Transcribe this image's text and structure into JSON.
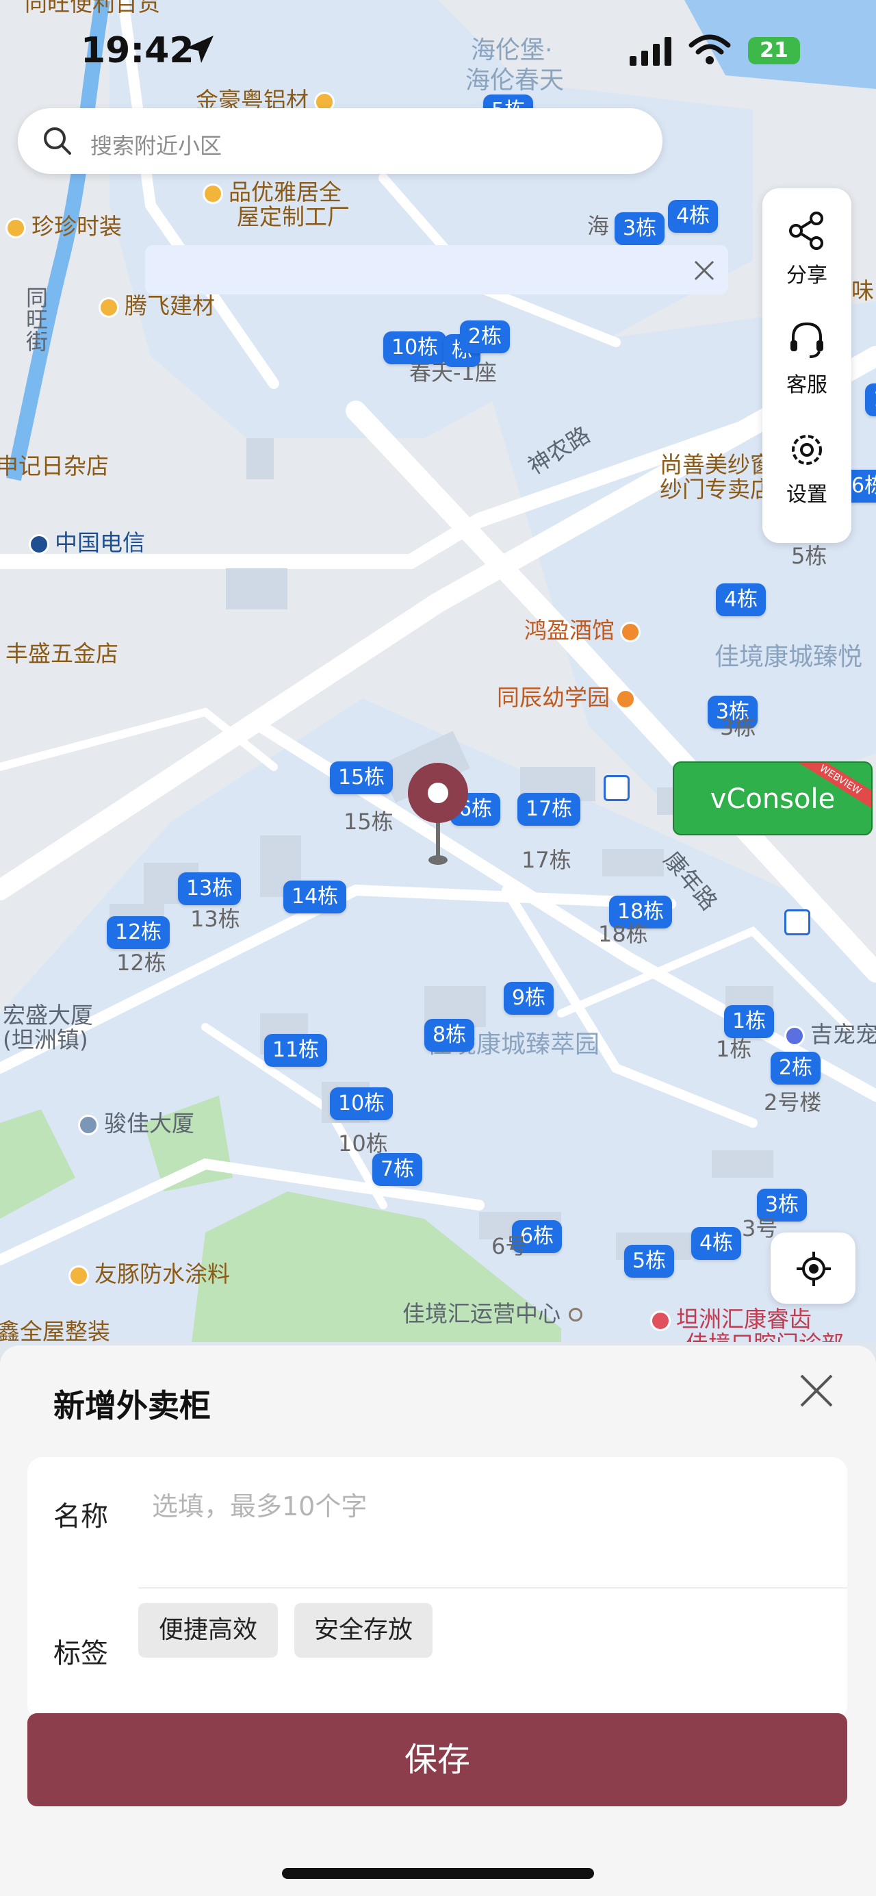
{
  "status_bar": {
    "time": "19:42",
    "battery": "21"
  },
  "search": {
    "placeholder": "搜索附近小区"
  },
  "side_panel": {
    "share": "分享",
    "service": "客服",
    "settings": "设置"
  },
  "vconsole": {
    "label": "vConsole",
    "ribbon": "WEBVIEW"
  },
  "map": {
    "pois": {
      "tongwang": "同旺便利百货",
      "jinhao": "金豪粤铝材",
      "haillunbao": "海伦堡·",
      "haillunchuntian": "海伦春天",
      "pinyou1": "品优雅居全",
      "pinyou2": "屋定制工厂",
      "zhenzhen": "珍珍时装",
      "tengfei": "腾飞建材",
      "riza": "申记日杂店",
      "dianxin": "中国电信",
      "wujin": "丰盛五金店",
      "jiudian": "鸿盈酒馆",
      "youxueyuan": "同辰幼学园",
      "shangshan1": "尚善美纱窗",
      "shangshan2": "纱门专卖店",
      "hongsheng1": "宏盛大厦",
      "hongsheng2": "(坦洲镇)",
      "junjia": "骏佳大厦",
      "youtun": "友豚防水涂料",
      "quanwu": "鑫全屋整装",
      "yunying": "佳境汇运营中心",
      "kangrui1": "坦洲汇康睿齿",
      "kangrui2": "佳境口腔门诊部",
      "jichong": "吉宠宠",
      "wei": "味"
    },
    "roads": {
      "tongwangjie": "同旺街",
      "shennonglu": "神农路",
      "kangnianlu": "康年路"
    },
    "areas": {
      "jiajingkangcheng_top": "佳境康城臻悦",
      "jiajingkangcheng_mid": "佳境康城臻萃园",
      "chuntian1zuo": "春天-1座",
      "hai": "海"
    },
    "building_markers": [
      "5栋",
      "3栋",
      "4栋",
      "10栋",
      "栋",
      "2栋",
      "1",
      "6栋",
      "4栋",
      "3栋",
      "15栋",
      "6栋",
      "17栋",
      "13栋",
      "14栋",
      "12栋",
      "18栋",
      "9栋",
      "8栋",
      "11栋",
      "1栋",
      "2栋",
      "10栋",
      "7栋",
      "3栋",
      "6栋",
      "5栋",
      "4栋"
    ],
    "building_texts": [
      "15栋",
      "17栋",
      "13栋",
      "12栋",
      "18栋",
      "10栋",
      "1栋",
      "2号楼",
      "5栋",
      "3栋",
      "6号",
      "3号"
    ]
  },
  "sheet": {
    "title": "新增外卖柜",
    "name_label": "名称",
    "name_placeholder": "选填，最多10个字",
    "tags_label": "标签",
    "tags": [
      "便捷高效",
      "安全存放"
    ],
    "save_label": "保存"
  }
}
